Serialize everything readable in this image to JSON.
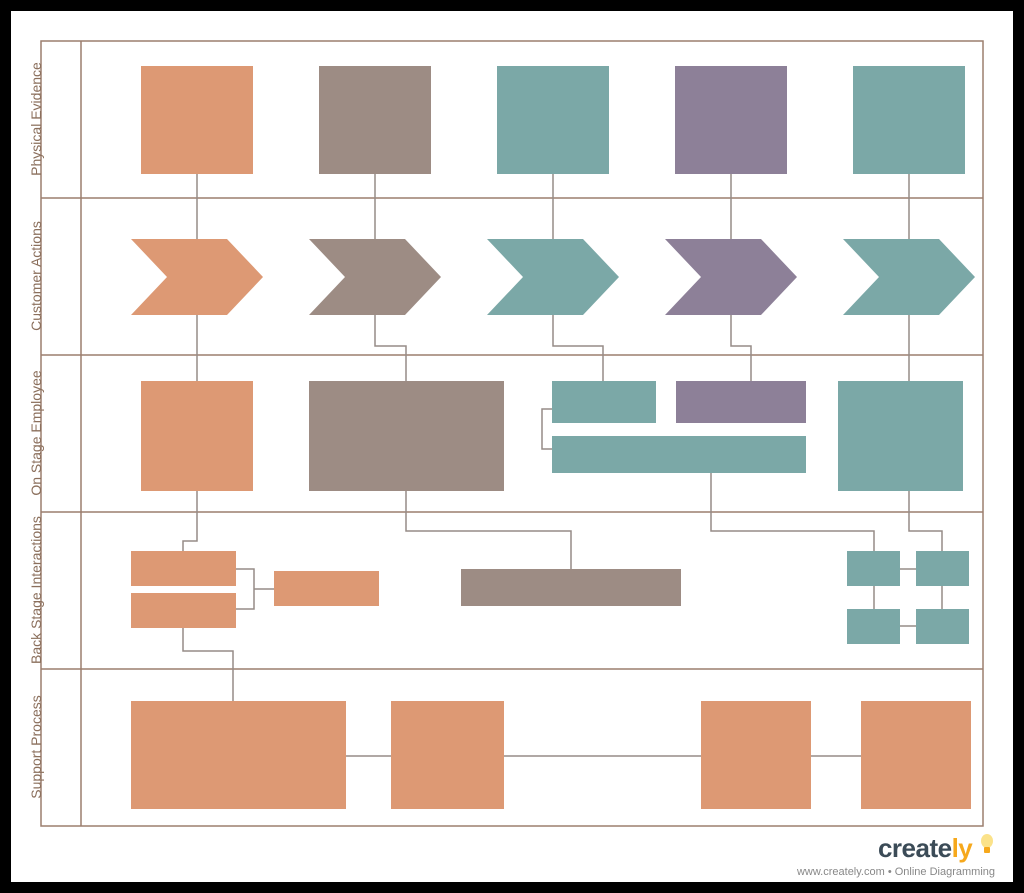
{
  "lanes": [
    {
      "label": "Physical Evidence"
    },
    {
      "label": "Customer Actions"
    },
    {
      "label": "On Stage Employee"
    },
    {
      "label": "Back Stage Interactions"
    },
    {
      "label": "Support Process"
    }
  ],
  "colors": {
    "orange": "#dd9974",
    "brown": "#9d8c84",
    "teal": "#7ba8a7",
    "purple": "#8d8098",
    "line": "#968c87",
    "frame": "#9c7f6e"
  },
  "branding": {
    "name": "creately",
    "tagline": "www.creately.com • Online Diagramming"
  }
}
